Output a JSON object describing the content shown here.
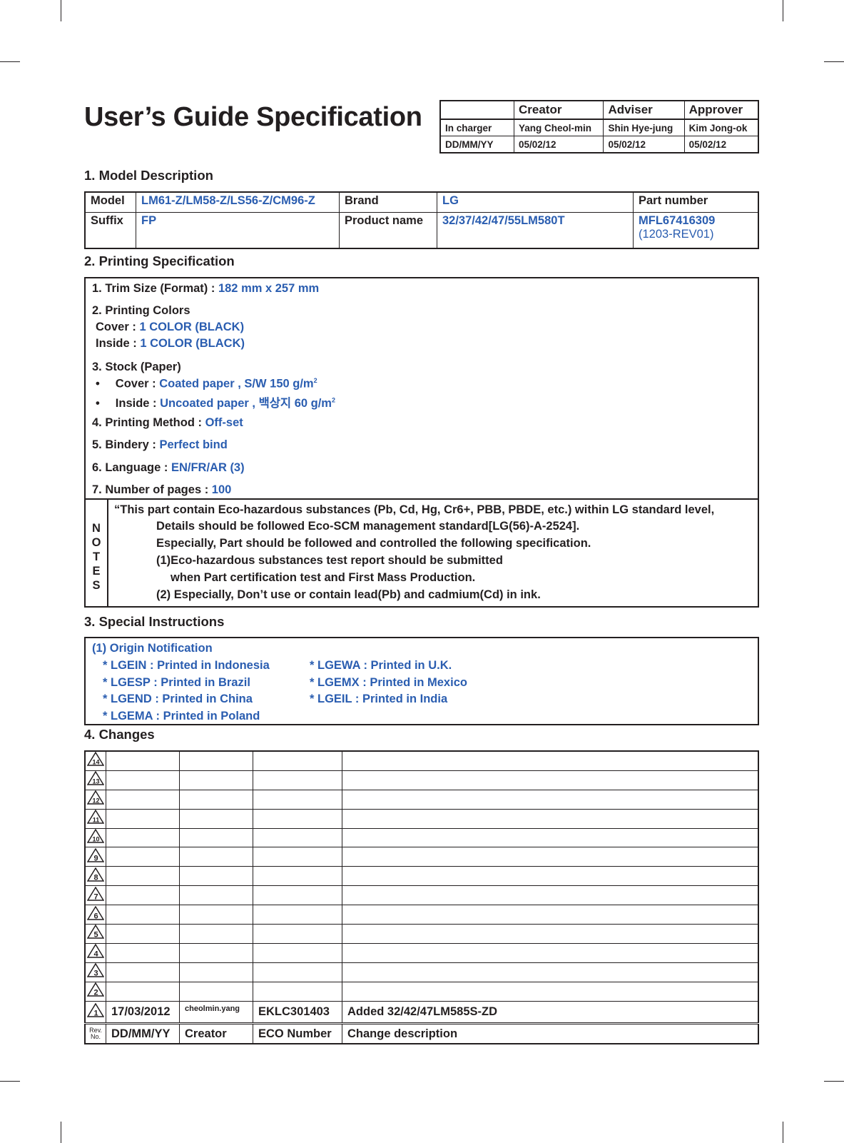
{
  "title": "User’s Guide Specification",
  "signoff": {
    "headers": [
      "",
      "Creator",
      "Adviser",
      "Approver"
    ],
    "rows": [
      [
        "In charger",
        "Yang Cheol-min",
        "Shin Hye-jung",
        "Kim Jong-ok"
      ],
      [
        "DD/MM/YY",
        "05/02/12",
        "05/02/12",
        "05/02/12"
      ]
    ]
  },
  "sections": {
    "model": "1. Model Description",
    "printing": "2. Printing Specification",
    "special": "3. Special Instructions",
    "changes": "4. Changes"
  },
  "model": {
    "model_label": "Model",
    "model_value": "LM61-Z/LM58-Z/LS56-Z/CM96-Z",
    "brand_label": "Brand",
    "brand_value": "LG",
    "part_label": "Part number",
    "suffix_label": "Suffix",
    "suffix_value": "FP",
    "product_label": "Product name",
    "product_value": "32/37/42/47/55LM580T",
    "part_value": "MFL67416309",
    "part_rev": "(1203-REV01)"
  },
  "printing": {
    "trim_label": "1. Trim Size (Format) : ",
    "trim_value": "182 mm x 257 mm",
    "colors_label": "2. Printing Colors",
    "cover_label": "Cover : ",
    "cover_value": "1 COLOR (BLACK)",
    "inside_label": "Inside : ",
    "inside_value": "1 COLOR (BLACK)",
    "stock_label": "3. Stock (Paper)",
    "stock_cover_label": "Cover : ",
    "stock_cover_value": "Coated paper , S/W 150 g/m",
    "stock_inside_label": "Inside : ",
    "stock_inside_value": "Uncoated paper , 백상지 60 g/m",
    "sup": "2",
    "bullet": "•",
    "method_label": "4. Printing Method : ",
    "method_value": "Off-set",
    "bindery_label": "5. Bindery  : ",
    "bindery_value": "Perfect bind",
    "language_label": "6. Language : ",
    "language_value": "EN/FR/AR (3)",
    "pages_label": "7. Number of pages : ",
    "pages_value": "100"
  },
  "notes": {
    "letters": [
      "N",
      "O",
      "T",
      "E",
      "S"
    ],
    "lines": [
      "“This part contain Eco-hazardous substances (Pb, Cd, Hg, Cr6+, PBB, PBDE, etc.) within LG standard level,",
      "Details should be followed Eco-SCM management standard[LG(56)-A-2524].",
      "Especially, Part should be followed and controlled the following specification.",
      "(1)Eco-hazardous substances test report should be submitted",
      "when  Part certification test and First Mass Production.",
      "(2) Especially, Don’t use or contain lead(Pb) and cadmium(Cd) in ink."
    ]
  },
  "special": {
    "heading": "(1) Origin Notification",
    "left": [
      "* LGEIN : Printed in Indonesia",
      "* LGESP : Printed in Brazil",
      "* LGEND : Printed in China",
      "* LGEMA : Printed in Poland"
    ],
    "right": [
      "* LGEWA : Printed in U.K.",
      "* LGEMX : Printed in Mexico",
      "* LGEIL : Printed in India"
    ]
  },
  "changes": {
    "rows": [
      {
        "rev": "14",
        "date": "",
        "creator": "",
        "eco": "",
        "desc": ""
      },
      {
        "rev": "13",
        "date": "",
        "creator": "",
        "eco": "",
        "desc": ""
      },
      {
        "rev": "12",
        "date": "",
        "creator": "",
        "eco": "",
        "desc": ""
      },
      {
        "rev": "11",
        "date": "",
        "creator": "",
        "eco": "",
        "desc": ""
      },
      {
        "rev": "10",
        "date": "",
        "creator": "",
        "eco": "",
        "desc": ""
      },
      {
        "rev": "9",
        "date": "",
        "creator": "",
        "eco": "",
        "desc": ""
      },
      {
        "rev": "8",
        "date": "",
        "creator": "",
        "eco": "",
        "desc": ""
      },
      {
        "rev": "7",
        "date": "",
        "creator": "",
        "eco": "",
        "desc": ""
      },
      {
        "rev": "6",
        "date": "",
        "creator": "",
        "eco": "",
        "desc": ""
      },
      {
        "rev": "5",
        "date": "",
        "creator": "",
        "eco": "",
        "desc": ""
      },
      {
        "rev": "4",
        "date": "",
        "creator": "",
        "eco": "",
        "desc": ""
      },
      {
        "rev": "3",
        "date": "",
        "creator": "",
        "eco": "",
        "desc": ""
      },
      {
        "rev": "2",
        "date": "",
        "creator": "",
        "eco": "",
        "desc": ""
      },
      {
        "rev": "1",
        "date": "17/03/2012",
        "creator": "cheolmin.yang",
        "eco": "EKLC301403",
        "desc": "Added 32/42/47LM585S-ZD"
      }
    ],
    "footer": {
      "rev_line1": "Rev.",
      "rev_line2": "No.",
      "date": "DD/MM/YY",
      "creator": "Creator",
      "eco": "ECO Number",
      "desc": "Change description"
    }
  }
}
